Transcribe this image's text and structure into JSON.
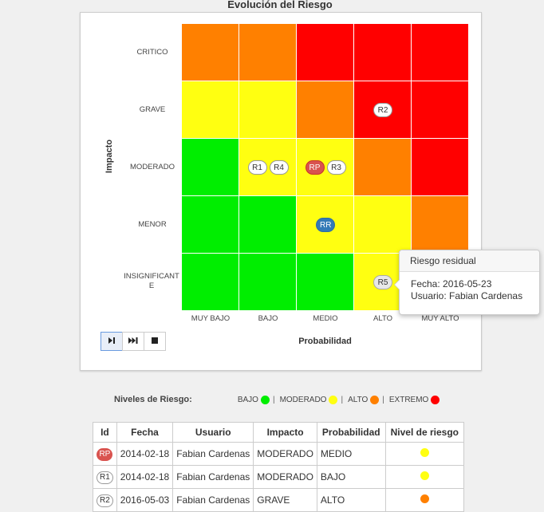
{
  "title": "Evolución del Riesgo",
  "colors": {
    "green": "#00ee00",
    "yellow": "#ffff11",
    "orange": "#ff8000",
    "red": "#ff0000"
  },
  "matrix": {
    "impact_label": "Impacto",
    "probability_label": "Probabilidad",
    "rows": [
      {
        "label": "CRITICO",
        "colors": [
          "orange",
          "orange",
          "red",
          "red",
          "red"
        ]
      },
      {
        "label": "GRAVE",
        "colors": [
          "yellow",
          "yellow",
          "orange",
          "red",
          "red"
        ]
      },
      {
        "label": "MODERADO",
        "colors": [
          "green",
          "yellow",
          "yellow",
          "orange",
          "red"
        ]
      },
      {
        "label": "MENOR",
        "colors": [
          "green",
          "green",
          "yellow",
          "yellow",
          "orange"
        ]
      },
      {
        "label": "INSIGNIFICANTE",
        "colors": [
          "green",
          "green",
          "green",
          "yellow",
          "yellow"
        ]
      }
    ],
    "columns": [
      "MUY BAJO",
      "BAJO",
      "MEDIO",
      "ALTO",
      "MUY ALTO"
    ],
    "markers": [
      {
        "label": "R2",
        "row": 1,
        "col": 3,
        "style": "plain"
      },
      {
        "label": "R1",
        "row": 2,
        "col": 1,
        "style": "plain"
      },
      {
        "label": "R4",
        "row": 2,
        "col": 1,
        "style": "plain"
      },
      {
        "label": "RP",
        "row": 2,
        "col": 2,
        "style": "red"
      },
      {
        "label": "R3",
        "row": 2,
        "col": 2,
        "style": "plain"
      },
      {
        "label": "RR",
        "row": 3,
        "col": 2,
        "style": "blue"
      },
      {
        "label": "R5",
        "row": 4,
        "col": 3,
        "style": "grey"
      }
    ]
  },
  "controls": {
    "play": "play-pause",
    "next": "skip-forward",
    "stop": "stop"
  },
  "tooltip": {
    "title": "Riesgo residual",
    "line1": "Fecha: 2016-05-23",
    "line2": "Usuario: Fabian Cardenas"
  },
  "legend": {
    "title": "Niveles de Riesgo:",
    "items": [
      {
        "label": "BAJO",
        "color": "#00ee00"
      },
      {
        "label": "MODERADO",
        "color": "#ffff11"
      },
      {
        "label": "ALTO",
        "color": "#ff8000"
      },
      {
        "label": "EXTREMO",
        "color": "#ff0000"
      }
    ],
    "separator": "|"
  },
  "table": {
    "headers": [
      "Id",
      "Fecha",
      "Usuario",
      "Impacto",
      "Probabilidad",
      "Nivel de riesgo"
    ],
    "rows": [
      {
        "id": "RP",
        "id_style": "red",
        "fecha": "2014-02-18",
        "usuario": "Fabian Cardenas",
        "impacto": "MODERADO",
        "probabilidad": "MEDIO",
        "nivel_color": "#ffff11"
      },
      {
        "id": "R1",
        "id_style": "plain",
        "fecha": "2014-02-18",
        "usuario": "Fabian Cardenas",
        "impacto": "MODERADO",
        "probabilidad": "BAJO",
        "nivel_color": "#ffff11"
      },
      {
        "id": "R2",
        "id_style": "plain",
        "fecha": "2016-05-03",
        "usuario": "Fabian Cardenas",
        "impacto": "GRAVE",
        "probabilidad": "ALTO",
        "nivel_color": "#ff8000"
      }
    ]
  }
}
